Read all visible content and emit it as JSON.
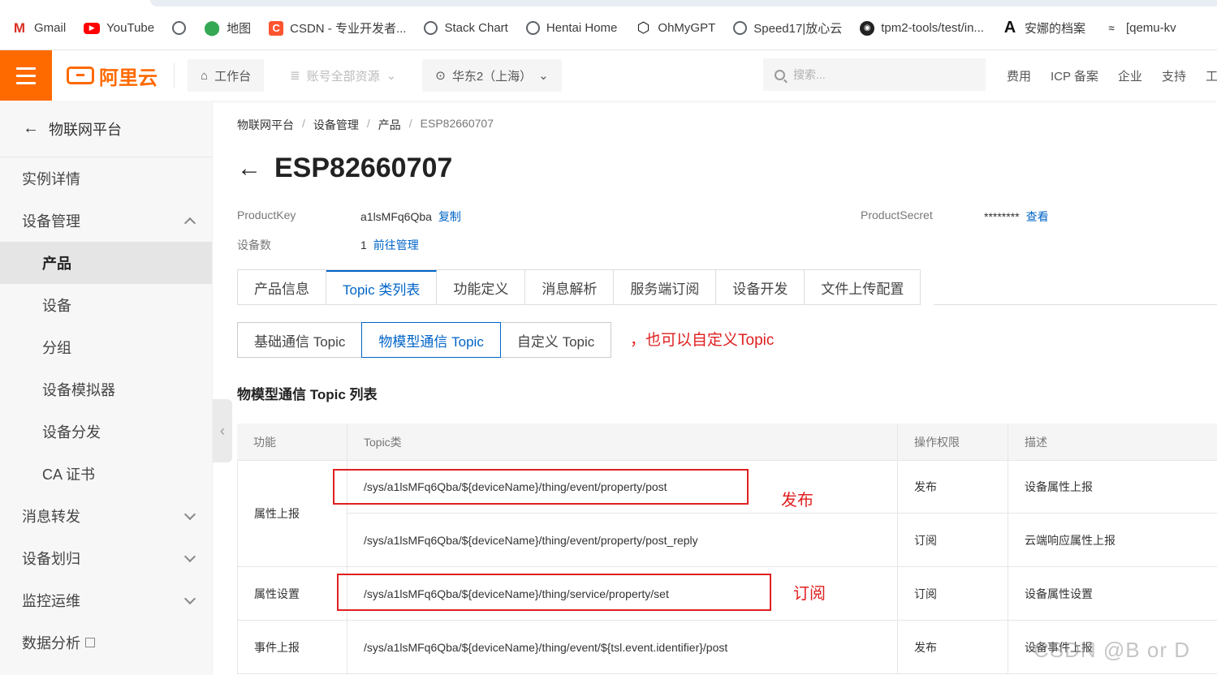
{
  "bookmarks": [
    {
      "icon": "gmail-icon",
      "glyph": "M",
      "label": "Gmail"
    },
    {
      "icon": "youtube-icon",
      "glyph": "▶",
      "label": "YouTube"
    },
    {
      "icon": "globe-icon",
      "glyph": "",
      "label": ""
    },
    {
      "icon": "maps-pin-icon",
      "glyph": "⬤",
      "label": "地图"
    },
    {
      "icon": "csdn-icon",
      "glyph": "C",
      "label": "CSDN - 专业开发者..."
    },
    {
      "icon": "globe-icon",
      "glyph": "",
      "label": "Stack Chart"
    },
    {
      "icon": "globe-icon",
      "glyph": "",
      "label": "Hentai Home"
    },
    {
      "icon": "openai-icon",
      "glyph": "⬡",
      "label": "OhMyGPT"
    },
    {
      "icon": "globe-icon",
      "glyph": "",
      "label": "Speed17|放心云"
    },
    {
      "icon": "github-icon",
      "glyph": "◉",
      "label": "tpm2-tools/test/in..."
    },
    {
      "icon": "archive-a-icon",
      "glyph": "A",
      "label": "安娜的档案"
    },
    {
      "icon": "misc-icon",
      "glyph": "≈",
      "label": "[qemu-kv"
    }
  ],
  "topbar": {
    "logo_text": "阿里云",
    "workbench": "工作台",
    "resources": "账号全部资源",
    "region": "华东2（上海）",
    "search_placeholder": "搜索...",
    "links": [
      "费用",
      "ICP 备案",
      "企业",
      "支持",
      "工"
    ]
  },
  "sidebar": {
    "header": "物联网平台",
    "items": [
      {
        "label": "实例详情",
        "sub": false,
        "active": false,
        "chevron": ""
      },
      {
        "label": "设备管理",
        "sub": false,
        "active": false,
        "chevron": "up"
      },
      {
        "label": "产品",
        "sub": true,
        "active": true,
        "chevron": ""
      },
      {
        "label": "设备",
        "sub": true,
        "active": false,
        "chevron": ""
      },
      {
        "label": "分组",
        "sub": true,
        "active": false,
        "chevron": ""
      },
      {
        "label": "设备模拟器",
        "sub": true,
        "active": false,
        "chevron": ""
      },
      {
        "label": "设备分发",
        "sub": true,
        "active": false,
        "chevron": ""
      },
      {
        "label": "CA 证书",
        "sub": true,
        "active": false,
        "chevron": ""
      },
      {
        "label": "消息转发",
        "sub": false,
        "active": false,
        "chevron": "down"
      },
      {
        "label": "设备划归",
        "sub": false,
        "active": false,
        "chevron": "down"
      },
      {
        "label": "监控运维",
        "sub": false,
        "active": false,
        "chevron": "down"
      },
      {
        "label": "数据分析",
        "sub": false,
        "active": false,
        "chevron": "external"
      }
    ]
  },
  "breadcrumb": [
    "物联网平台",
    "设备管理",
    "产品",
    "ESP82660707"
  ],
  "page_title": "ESP82660707",
  "product": {
    "key_label": "ProductKey",
    "key_value": "a1lsMFq6Qba",
    "copy_link": "复制",
    "secret_label": "ProductSecret",
    "secret_value": "********",
    "view_link": "查看",
    "device_count_label": "设备数",
    "device_count": "1",
    "manage_link": "前往管理"
  },
  "tabs": [
    "产品信息",
    "Topic 类列表",
    "功能定义",
    "消息解析",
    "服务端订阅",
    "设备开发",
    "文件上传配置"
  ],
  "active_tab": 1,
  "subtabs": [
    "基础通信 Topic",
    "物模型通信 Topic",
    "自定义 Topic"
  ],
  "active_subtab": 1,
  "annotation_custom": "，也可以自定义Topic",
  "section_title": "物模型通信 Topic 列表",
  "table": {
    "headers": [
      "功能",
      "Topic类",
      "操作权限",
      "描述"
    ],
    "groups": [
      {
        "label": "属性上报",
        "rows": [
          {
            "topic": "/sys/a1lsMFq6Qba/${deviceName}/thing/event/property/post",
            "perm": "发布",
            "desc": "设备属性上报"
          },
          {
            "topic": "/sys/a1lsMFq6Qba/${deviceName}/thing/event/property/post_reply",
            "perm": "订阅",
            "desc": "云端响应属性上报"
          }
        ]
      },
      {
        "label": "属性设置",
        "rows": [
          {
            "topic": "/sys/a1lsMFq6Qba/${deviceName}/thing/service/property/set",
            "perm": "订阅",
            "desc": "设备属性设置"
          }
        ]
      },
      {
        "label": "事件上报",
        "rows": [
          {
            "topic": "/sys/a1lsMFq6Qba/${deviceName}/thing/event/${tsl.event.identifier}/post",
            "perm": "发布",
            "desc": "设备事件上报"
          }
        ]
      }
    ]
  },
  "annotations": {
    "publish": "发布",
    "subscribe": "订阅"
  },
  "watermark": "CSDN @B   or   D",
  "colors": {
    "accent": "#ff6a00",
    "link": "#0064c8",
    "annotation_red": "#e02020"
  }
}
